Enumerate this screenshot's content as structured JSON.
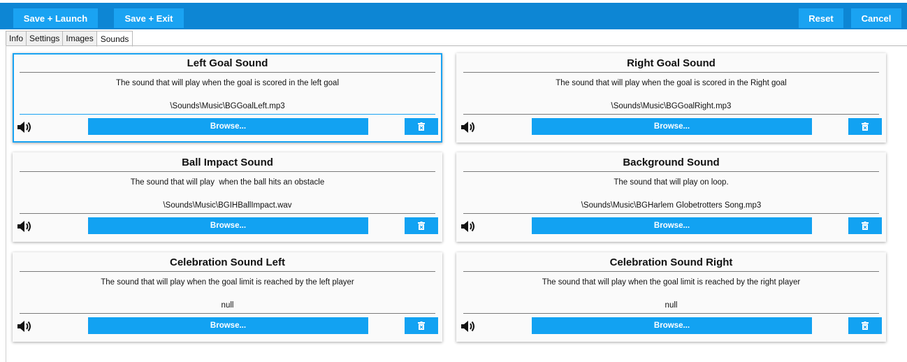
{
  "toolbar": {
    "save_launch_label": "Save + Launch",
    "save_exit_label": "Save + Exit",
    "reset_label": "Reset",
    "cancel_label": "Cancel"
  },
  "tabs": [
    {
      "label": "Info"
    },
    {
      "label": "Settings"
    },
    {
      "label": "Images"
    },
    {
      "label": "Sounds"
    }
  ],
  "active_tab": "Sounds",
  "colors": {
    "toolbar_bg": "#0d86d4",
    "button_bg": "#1aa3f2",
    "focus_border": "#1aa3f2"
  },
  "sounds": [
    {
      "title": "Left Goal Sound",
      "description": "The sound that will play when the goal is scored in the left goal",
      "path": "\\Sounds\\Music\\BGGoalLeft.mp3",
      "browse_label": "Browse...",
      "speaker_icon": "speaker-icon",
      "delete_icon": "trash-icon"
    },
    {
      "title": "Right Goal Sound",
      "description": "The sound that will play when the goal is scored in the Right goal",
      "path": "\\Sounds\\Music\\BGGoalRight.mp3",
      "browse_label": "Browse...",
      "speaker_icon": "speaker-icon",
      "delete_icon": "trash-icon"
    },
    {
      "title": "Ball Impact Sound",
      "description": "The sound that will play  when the ball hits an obstacle",
      "path": "\\Sounds\\Music\\BGIHBallImpact.wav",
      "browse_label": "Browse...",
      "speaker_icon": "speaker-icon",
      "delete_icon": "trash-icon"
    },
    {
      "title": "Background Sound",
      "description": "The sound that will play on loop.",
      "path": "\\Sounds\\Music\\BGHarlem Globetrotters Song.mp3",
      "browse_label": "Browse...",
      "speaker_icon": "speaker-icon",
      "delete_icon": "trash-icon"
    },
    {
      "title": "Celebration Sound Left",
      "description": "The sound that will play when the goal limit is reached by the left player",
      "path": "null",
      "browse_label": "Browse...",
      "speaker_icon": "speaker-icon",
      "delete_icon": "trash-icon"
    },
    {
      "title": "Celebration Sound Right",
      "description": "The sound that will play when the goal limit is reached by the right player",
      "path": "null",
      "browse_label": "Browse...",
      "speaker_icon": "speaker-icon",
      "delete_icon": "trash-icon"
    }
  ]
}
